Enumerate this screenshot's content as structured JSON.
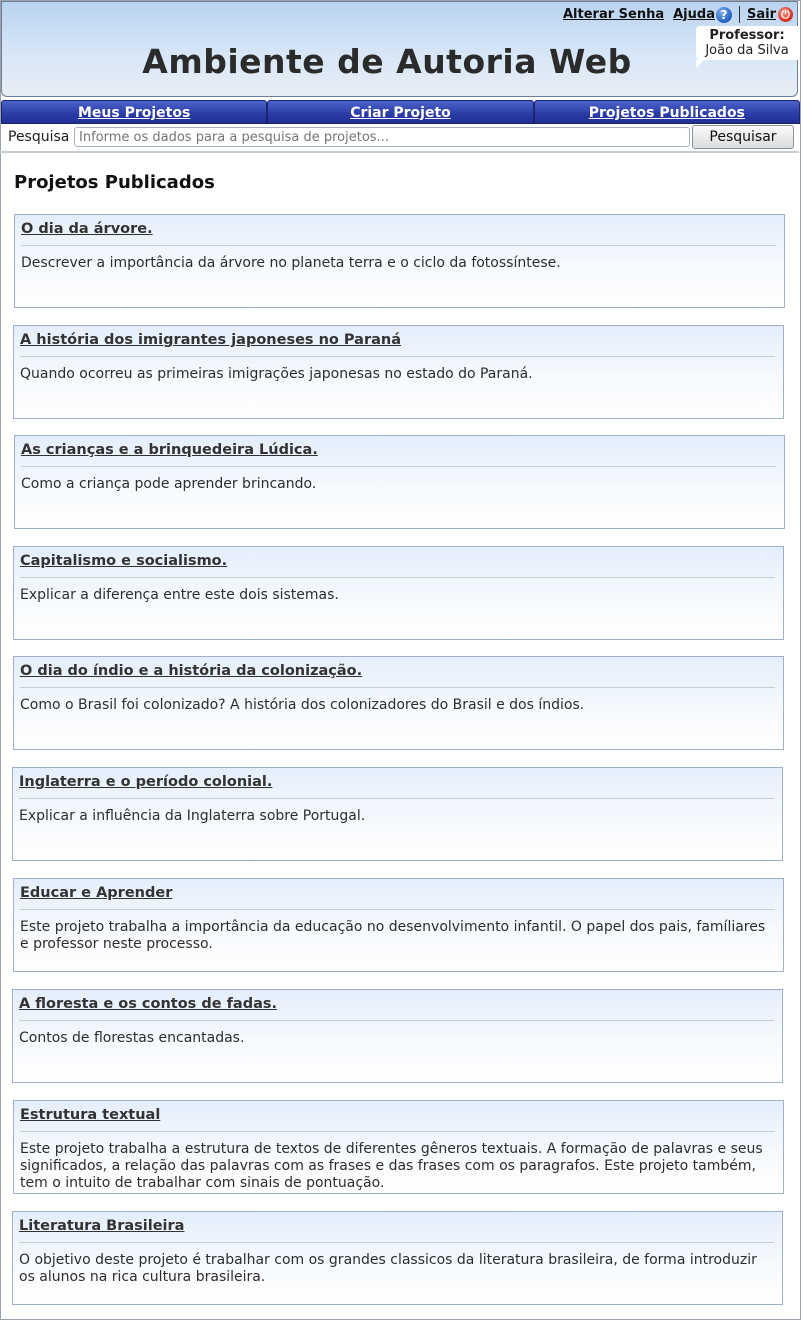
{
  "header": {
    "app_title": "Ambiente de Autoria Web",
    "change_password_label": "Alterar Senha",
    "help_label": "Ajuda",
    "logout_label": "Sair",
    "professor_role": "Professor:",
    "professor_name": "João da Silva"
  },
  "nav": {
    "tabs": [
      {
        "label": "Meus Projetos"
      },
      {
        "label": "Criar Projeto"
      },
      {
        "label": "Projetos Publicados"
      }
    ]
  },
  "search": {
    "label": "Pesquisa",
    "placeholder": "Informe os dados para a pesquisa de projetos...",
    "button_label": "Pesquisar"
  },
  "main": {
    "section_title": "Projetos Publicados",
    "projects": [
      {
        "title": "O dia da árvore.",
        "description": "Descrever a importância da árvore no planeta terra e o ciclo da fotossíntese."
      },
      {
        "title": "A história dos imigrantes japoneses no Paraná",
        "description": "Quando ocorreu as primeiras imigrações japonesas no estado do Paraná."
      },
      {
        "title": "As crianças e a brinquedeira Lúdica.",
        "description": "Como a criança pode aprender brincando."
      },
      {
        "title": "Capitalismo e socialismo.",
        "description": "Explicar a diferença entre este dois sistemas."
      },
      {
        "title": "O dia do índio e a história da colonização.",
        "description": "Como o Brasil foi colonizado? A história dos colonizadores do Brasil e dos índios."
      },
      {
        "title": "Inglaterra e o período colonial.",
        "description": "Explicar a influência da Inglaterra sobre Portugal."
      },
      {
        "title": "Educar e Aprender",
        "description": "Este projeto trabalha a importância da educação no desenvolvimento infantil. O papel dos pais, famíliares e professor neste processo."
      },
      {
        "title": "A floresta e os contos de fadas.",
        "description": "Contos de florestas encantadas."
      },
      {
        "title": "Estrutura textual",
        "description": "Este projeto trabalha a estrutura de textos de diferentes gêneros textuais. A formação de palavras e seus significados, a relação das palavras com as frases e das frases com os paragrafos. Este projeto também, tem o intuito de trabalhar com sinais de pontuação."
      },
      {
        "title": "Literatura Brasileira",
        "description": "O objetivo deste projeto é trabalhar com os grandes classicos da literatura brasileira, de forma introduzir os alunos na rica cultura brasileira."
      }
    ]
  }
}
